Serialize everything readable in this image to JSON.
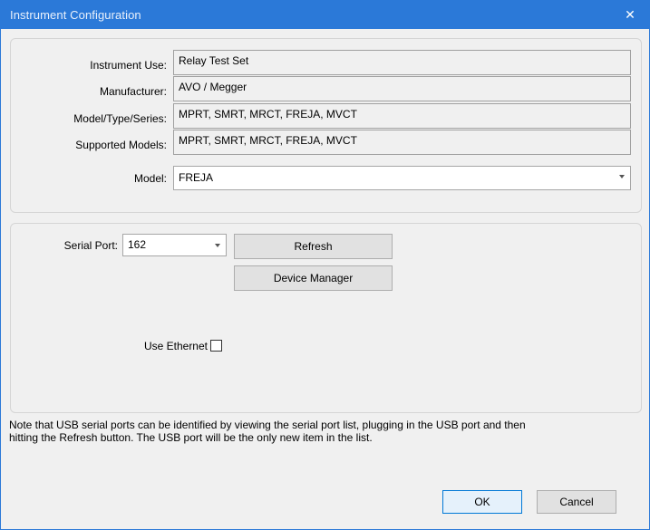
{
  "window": {
    "title": "Instrument Configuration",
    "close_glyph": "✕"
  },
  "instrument": {
    "use_label": "Instrument Use:",
    "use_value": "Relay Test Set",
    "manufacturer_label": "Manufacturer:",
    "manufacturer_value": "AVO / Megger",
    "series_label": "Model/Type/Series:",
    "series_value": "MPRT, SMRT, MRCT, FREJA, MVCT",
    "supported_label": "Supported Models:",
    "supported_value": "MPRT, SMRT, MRCT, FREJA, MVCT",
    "model_label": "Model:",
    "model_value": "FREJA"
  },
  "connection": {
    "serial_port_label": "Serial Port:",
    "serial_port_value": "162",
    "refresh_label": "Refresh",
    "device_manager_label": "Device Manager",
    "use_ethernet_label": "Use Ethernet",
    "use_ethernet_checked": false
  },
  "note": {
    "line1": "Note that USB serial ports can be identified by viewing the serial port list, plugging in the USB port and then",
    "line2": "hitting the Refresh button.  The USB port will be the only new item in the list."
  },
  "footer": {
    "ok_label": "OK",
    "cancel_label": "Cancel"
  },
  "colors": {
    "titlebar": "#2b79d8",
    "dialog_bg": "#f0f0f0",
    "default_button_border": "#0078d7"
  },
  "icons": {
    "close": "close-icon",
    "dropdown": "chevron-down-icon"
  }
}
